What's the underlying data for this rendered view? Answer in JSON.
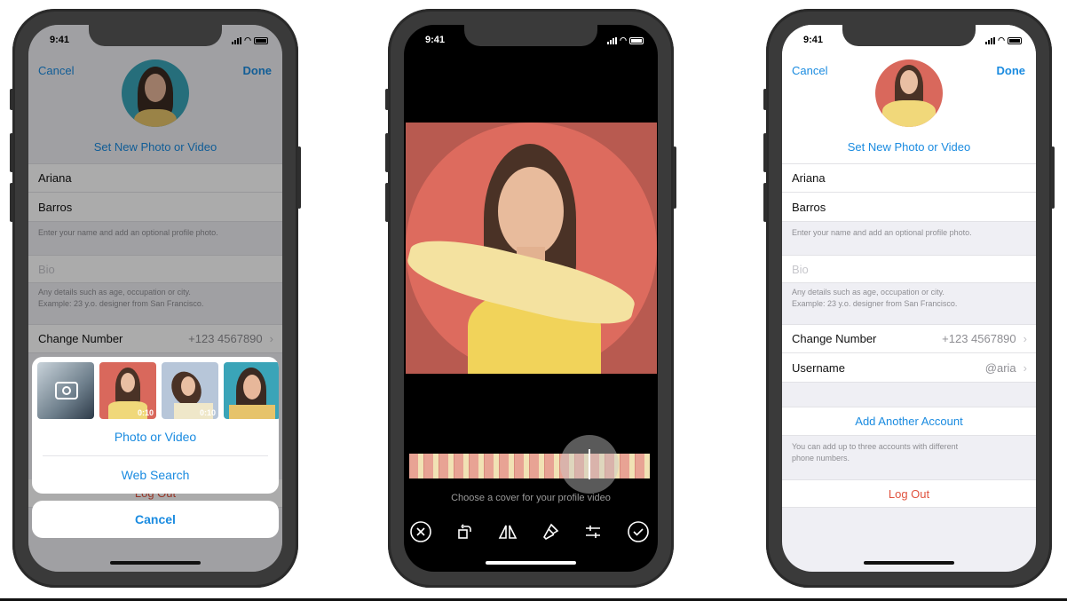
{
  "status": {
    "time": "9:41"
  },
  "left_phone": {
    "nav": {
      "cancel": "Cancel",
      "done": "Done"
    },
    "set_photo": "Set New Photo or Video",
    "first_name": "Ariana",
    "last_name": "Barros",
    "name_hint": "Enter your name and add an optional profile photo.",
    "bio_placeholder": "Bio",
    "bio_hint_1": "Any details such as age, occupation or city.",
    "bio_hint_2": "Example: 23 y.o. designer from San Francisco.",
    "change_number": {
      "label": "Change Number",
      "value": "+123 4567890"
    },
    "log_out": "Log Out",
    "sheet": {
      "thumb_durations": [
        "0:10",
        "0:10"
      ],
      "photo_or_video": "Photo or Video",
      "web_search": "Web Search",
      "cancel": "Cancel"
    }
  },
  "middle_phone": {
    "cover_hint": "Choose a cover for your profile video",
    "tools": [
      "close-icon",
      "rotate-icon",
      "mirror-icon",
      "brush-icon",
      "adjust-icon",
      "checkmark-icon"
    ]
  },
  "right_phone": {
    "nav": {
      "cancel": "Cancel",
      "done": "Done"
    },
    "set_photo": "Set New Photo or Video",
    "first_name": "Ariana",
    "last_name": "Barros",
    "name_hint": "Enter your name and add an optional profile photo.",
    "bio_placeholder": "Bio",
    "bio_hint_1": "Any details such as age, occupation or city.",
    "bio_hint_2": "Example: 23 y.o. designer from San Francisco.",
    "change_number": {
      "label": "Change Number",
      "value": "+123 4567890"
    },
    "username": {
      "label": "Username",
      "value": "@aria"
    },
    "add_account": "Add Another Account",
    "add_account_hint_1": "You can add up to three accounts with different",
    "add_account_hint_2": "phone numbers.",
    "log_out": "Log Out"
  },
  "colors": {
    "accent": "#1a8be0",
    "destructive": "#e0533f",
    "photo_bg": "#d9685c"
  }
}
